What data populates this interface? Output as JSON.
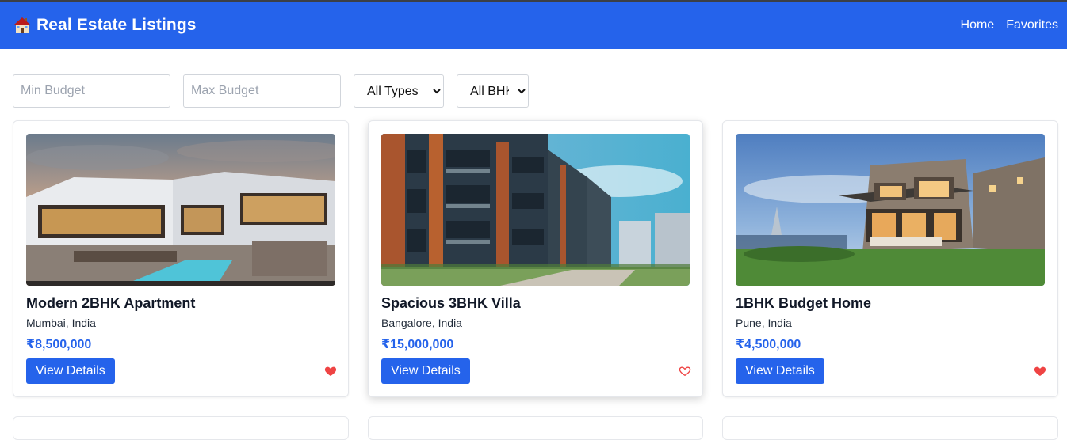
{
  "header": {
    "title": "Real Estate Listings",
    "logo_icon": "house-icon",
    "nav": [
      {
        "label": "Home"
      },
      {
        "label": "Favorites"
      }
    ],
    "bg_color": "#2563eb"
  },
  "filters": {
    "min_budget": {
      "placeholder": "Min Budget",
      "value": ""
    },
    "max_budget": {
      "placeholder": "Max Budget",
      "value": ""
    },
    "type_select": {
      "selected": "All Types"
    },
    "bhk_select": {
      "selected": "All BHK"
    }
  },
  "listings": [
    {
      "title": "Modern 2BHK Apartment",
      "location": "Mumbai, India",
      "price": "₹8,500,000",
      "button": "View Details",
      "favorited": true
    },
    {
      "title": "Spacious 3BHK Villa",
      "location": "Bangalore, India",
      "price": "₹15,000,000",
      "button": "View Details",
      "favorited": false
    },
    {
      "title": "1BHK Budget Home",
      "location": "Pune, India",
      "price": "₹4,500,000",
      "button": "View Details",
      "favorited": true
    }
  ],
  "colors": {
    "accent": "#2563eb",
    "heart": "#ef4444"
  }
}
